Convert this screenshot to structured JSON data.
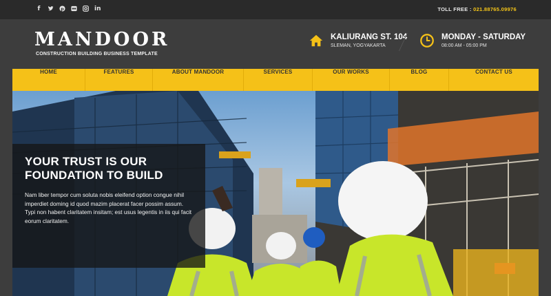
{
  "topbar": {
    "social_icons": [
      "facebook-icon",
      "twitter-icon",
      "pinterest-icon",
      "flickr-icon",
      "instagram-icon",
      "linkedin-icon"
    ],
    "toll_free_label": "TOLL FREE :",
    "toll_free_number": "021.88765.09976"
  },
  "header": {
    "logo": "MANDOOR",
    "tagline": "CONSTRUCTION BUILDING BUSINESS TEMPLATE",
    "address": {
      "title": "KALIURANG ST. 104",
      "sub": "SLEMAN, YOGYAKARTA",
      "icon": "home-icon"
    },
    "hours": {
      "title": "MONDAY - SATURDAY",
      "sub": "08:00 AM - 05:00 PM",
      "icon": "clock-icon"
    }
  },
  "nav": {
    "items": [
      "HOME",
      "FEATURES",
      "ABOUT MANDOOR",
      "SERVICES",
      "OUR WORKS",
      "BLOG",
      "CONTACT US"
    ]
  },
  "hero": {
    "heading_line1": "YOUR TRUST IS OUR",
    "heading_line2": "FOUNDATION TO BUILD",
    "body": "Nam liber tempor cum soluta nobis eleifend option congue nihil imperdiet doming id quod mazim placerat facer possim assum. Typi non habent claritatem insitam; est usus legentis in iis qui facit eorum claritatem."
  },
  "colors": {
    "accent": "#f5c118",
    "topbar_bg": "#2a2a2a",
    "header_bg": "#3d3d3d",
    "toll_free_number": "#f5c518"
  }
}
